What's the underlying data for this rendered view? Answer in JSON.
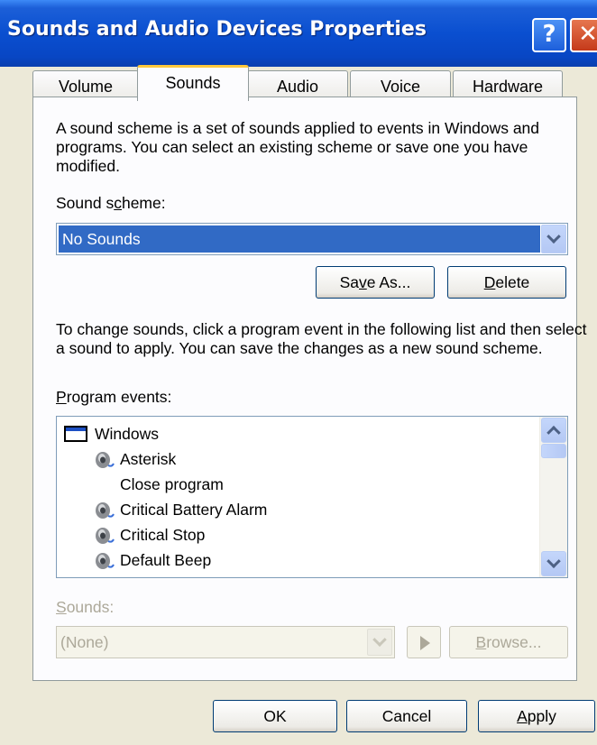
{
  "window": {
    "title": "Sounds and Audio Devices Properties",
    "help_label": "?",
    "close_label": "✕"
  },
  "tabs": [
    {
      "label": "Volume",
      "active": false
    },
    {
      "label": "Sounds",
      "active": true
    },
    {
      "label": "Audio",
      "active": false
    },
    {
      "label": "Voice",
      "active": false
    },
    {
      "label": "Hardware",
      "active": false
    }
  ],
  "sounds_tab": {
    "intro": "A sound scheme is a set of sounds applied to events in Windows and programs. You can select an existing scheme or save one you have modified.",
    "scheme_label": {
      "before": "Sound s",
      "accel": "c",
      "after": "heme:"
    },
    "scheme_value": "No Sounds",
    "save_as": {
      "before": "Sa",
      "accel": "v",
      "after": "e As..."
    },
    "delete": {
      "before": "",
      "accel": "D",
      "after": "elete"
    },
    "change_text": "To change sounds, click a program event in the following list and then select a sound to apply. You can save the changes as a new sound scheme.",
    "events_label": {
      "before": "",
      "accel": "P",
      "after": "rogram events:"
    },
    "events": [
      {
        "label": "Windows",
        "icon": "window-icon",
        "level": 0
      },
      {
        "label": "Asterisk",
        "icon": "speaker-icon",
        "level": 1
      },
      {
        "label": "Close program",
        "icon": "",
        "level": 1
      },
      {
        "label": "Critical Battery Alarm",
        "icon": "speaker-icon",
        "level": 1
      },
      {
        "label": "Critical Stop",
        "icon": "speaker-icon",
        "level": 1
      },
      {
        "label": "Default Beep",
        "icon": "speaker-icon",
        "level": 1
      }
    ],
    "sounds_label": {
      "before": "",
      "accel": "S",
      "after": "ounds:"
    },
    "sounds_value": "(None)",
    "browse": {
      "before": "",
      "accel": "B",
      "after": "rowse..."
    }
  },
  "footer": {
    "ok": "OK",
    "cancel": "Cancel",
    "apply": {
      "before": "",
      "accel": "A",
      "after": "pply"
    }
  },
  "colors": {
    "titlebar": "#0a4fd0",
    "selection": "#316ac5",
    "dialog_bg": "#ece9d8",
    "active_tab_accent": "#ffc83c"
  }
}
